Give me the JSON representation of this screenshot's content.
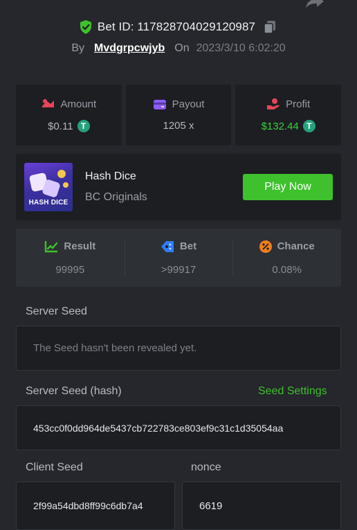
{
  "header": {
    "bet_id_label": "Bet ID: 117828704029120987",
    "by_label": "By",
    "username": "Mvdgrpcwjyb",
    "on_label": "On",
    "date": "2023/3/10 6:02:20"
  },
  "stats": [
    {
      "label": "Amount",
      "value": "$0.11",
      "coin": "T",
      "icon": "amount-icon",
      "color": "#e8445a"
    },
    {
      "label": "Payout",
      "value": "1205 x",
      "icon": "wallet-icon",
      "color": "#8d5cf6"
    },
    {
      "label": "Profit",
      "value": "$132.44",
      "coin": "T",
      "icon": "profit-icon",
      "color": "#e8445a"
    }
  ],
  "game": {
    "title": "Hash Dice",
    "subtitle": "BC Originals",
    "thumb_label": "HASH DICE",
    "play_label": "Play Now"
  },
  "result": [
    {
      "label": "Result",
      "value": "99995",
      "icon": "result-chart-icon",
      "color": "#3ec12d"
    },
    {
      "label": "Bet",
      "value": ">99917",
      "icon": "bet-tag-icon",
      "color": "#2f7df6"
    },
    {
      "label": "Chance",
      "value": "0.08%",
      "icon": "percent-icon",
      "color": "#f07f1c"
    }
  ],
  "server_seed": {
    "label": "Server Seed",
    "value": "The Seed hasn't been revealed yet."
  },
  "server_seed_hash": {
    "label": "Server Seed (hash)",
    "settings_label": "Seed Settings",
    "value": "453cc0f0dd964de5437cb722783ce803ef9c31c1d35054aa"
  },
  "client_seed": {
    "label": "Client Seed",
    "value": "2f99a54dbd8ff99c6db7a4"
  },
  "nonce": {
    "label": "nonce",
    "value": "6619"
  },
  "colors": {
    "accent_green": "#3ec12d",
    "background": "#25272c",
    "card": "#1c1e22"
  }
}
